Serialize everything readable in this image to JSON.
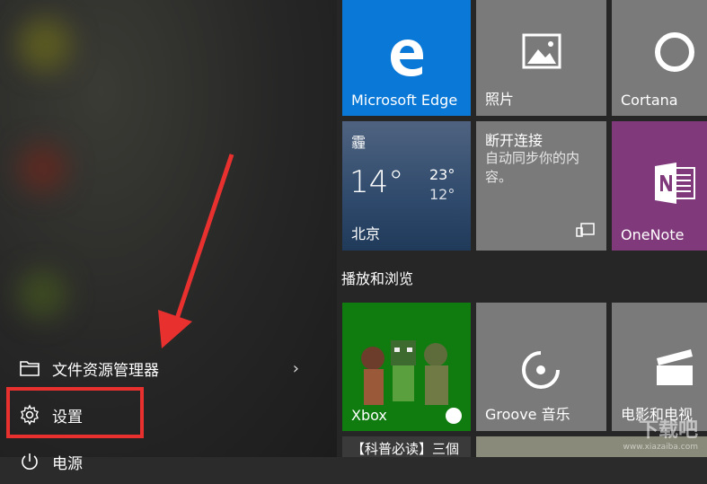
{
  "left_menu": {
    "file_explorer": {
      "label": "文件资源管理器"
    },
    "settings": {
      "label": "设置"
    },
    "power": {
      "label": "电源"
    }
  },
  "tiles": {
    "edge": {
      "label": "Microsoft Edge",
      "color": "#0a78d7"
    },
    "photos": {
      "label": "照片",
      "color": "#7a7a7a"
    },
    "cortana": {
      "label": "Cortana",
      "color": "#7a7a7a"
    },
    "weather": {
      "condition": "霾",
      "temp": "14°",
      "high": "23°",
      "low": "12°",
      "city": "北京"
    },
    "disconnected": {
      "title": "断开连接",
      "desc": "自动同步你的内容。",
      "color": "#7a7a7a"
    },
    "onenote": {
      "label": "OneNote",
      "color": "#80397b"
    },
    "xbox": {
      "label": "Xbox",
      "color": "#107c10"
    },
    "groove": {
      "label": "Groove 音乐",
      "color": "#7a7a7a"
    },
    "movies": {
      "label": "电影和电视",
      "color": "#7a7a7a"
    },
    "news": {
      "label": "【科普必读】三個"
    }
  },
  "section": {
    "title": "播放和浏览"
  },
  "watermark": {
    "text": "下载吧",
    "url": "www.xiazaiba.com"
  }
}
